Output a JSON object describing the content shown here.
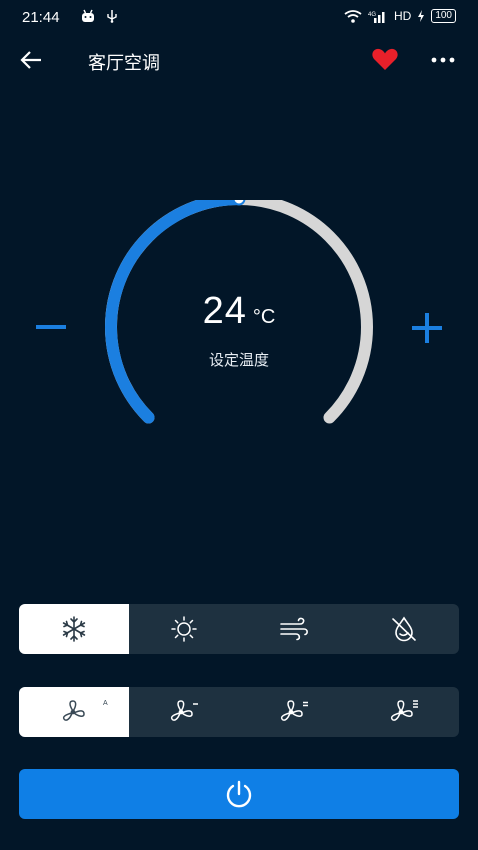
{
  "status_bar": {
    "time": "21:44",
    "network": "HD",
    "signal_label": "4G",
    "battery": "100"
  },
  "header": {
    "title": "客厅空调",
    "favorite_color": "#e8202a"
  },
  "thermostat": {
    "temperature": "24",
    "unit": "°C",
    "label": "设定温度",
    "level": 0.5,
    "active_color": "#1b7fe0",
    "track_color": "#d6d6d6"
  },
  "modes": [
    {
      "icon": "snowflake-icon",
      "active": true
    },
    {
      "icon": "sun-icon",
      "active": false
    },
    {
      "icon": "wind-icon",
      "active": false
    },
    {
      "icon": "dry-icon",
      "active": false
    }
  ],
  "fan_speeds": [
    {
      "icon": "fan-auto-icon",
      "sup": "A",
      "active": true
    },
    {
      "icon": "fan-low-icon",
      "sup": "",
      "active": false
    },
    {
      "icon": "fan-medium-icon",
      "sup": "",
      "active": false
    },
    {
      "icon": "fan-high-icon",
      "sup": "",
      "active": false
    }
  ],
  "colors": {
    "background": "#021628",
    "accent": "#0f7fe6",
    "segment_bg": "#1e3140"
  }
}
